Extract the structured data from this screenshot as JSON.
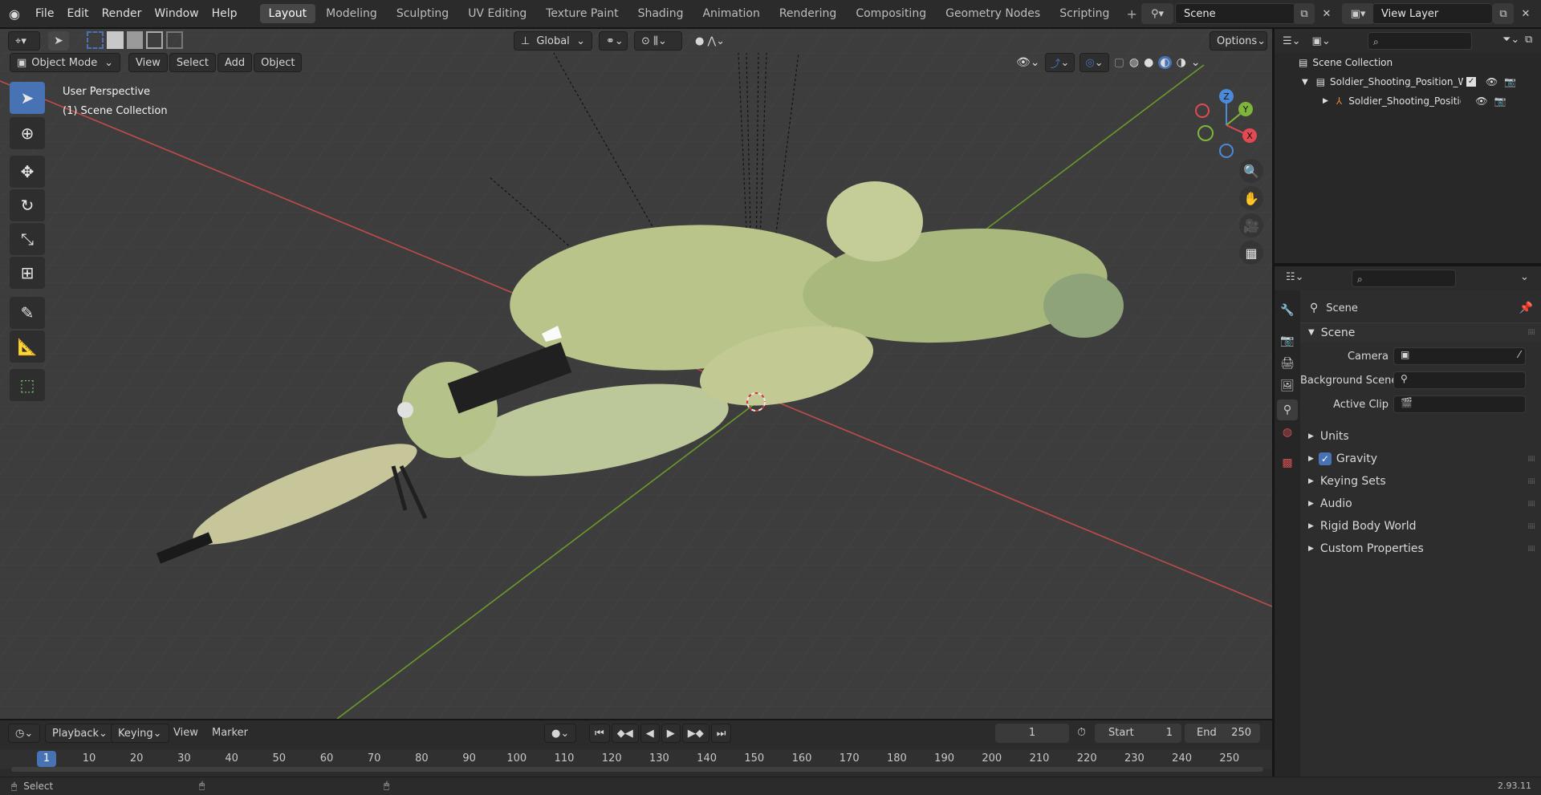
{
  "topbar": {
    "menus": [
      "File",
      "Edit",
      "Render",
      "Window",
      "Help"
    ],
    "tabs": [
      "Layout",
      "Modeling",
      "Sculpting",
      "UV Editing",
      "Texture Paint",
      "Shading",
      "Animation",
      "Rendering",
      "Compositing",
      "Geometry Nodes",
      "Scripting"
    ],
    "active_tab": "Layout",
    "scene_name": "Scene",
    "view_layer": "View Layer"
  },
  "viewport": {
    "mode": "Object Mode",
    "menus": [
      "View",
      "Select",
      "Add",
      "Object"
    ],
    "orientation": "Global",
    "options_label": "Options",
    "perspective": "User Perspective",
    "collection": "(1) Scene Collection",
    "gizmo": {
      "x": "X",
      "y": "Y",
      "z": "Z"
    }
  },
  "outliner": {
    "root": "Scene Collection",
    "items": [
      {
        "label": "Soldier_Shooting_Position_Wc"
      },
      {
        "label": "Soldier_Shooting_Positior"
      }
    ]
  },
  "properties": {
    "header": "Scene",
    "panel_title": "Scene",
    "fields": [
      {
        "label": "Camera"
      },
      {
        "label": "Background Scene"
      },
      {
        "label": "Active Clip"
      }
    ],
    "sections": [
      "Units",
      "Gravity",
      "Keying Sets",
      "Audio",
      "Rigid Body World",
      "Custom Properties"
    ],
    "gravity_checked": true
  },
  "timeline": {
    "menus": [
      "Playback",
      "Keying",
      "View",
      "Marker"
    ],
    "current_frame": "1",
    "start_label": "Start",
    "start_value": "1",
    "end_label": "End",
    "end_value": "250",
    "frame_marker": "1",
    "ruler": [
      "10",
      "20",
      "30",
      "40",
      "50",
      "60",
      "70",
      "80",
      "90",
      "100",
      "110",
      "120",
      "130",
      "140",
      "150",
      "160",
      "170",
      "180",
      "190",
      "200",
      "210",
      "220",
      "230",
      "240",
      "250"
    ]
  },
  "status": {
    "left": "Select",
    "version": "2.93.11"
  },
  "colors": {
    "accent": "#4772b3",
    "x_axis": "#c14b4b",
    "y_axis": "#6a9a2a",
    "viewport_bg": "#3d3d3d",
    "foliage": "#b8c48a"
  }
}
